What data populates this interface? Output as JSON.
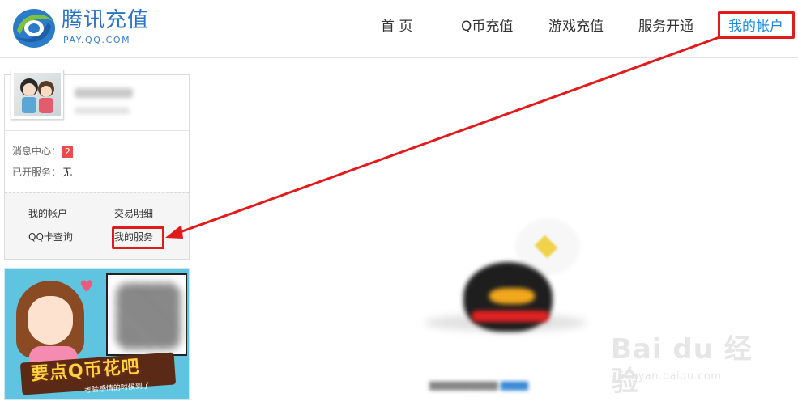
{
  "header": {
    "logo_cn": "腾讯充值",
    "logo_en": "PAY.QQ.COM",
    "nav": [
      {
        "label": "首  页"
      },
      {
        "label": "Q币充值"
      },
      {
        "label": "游戏充值"
      },
      {
        "label": "服务开通"
      },
      {
        "label": "我的帐户"
      }
    ],
    "active_index": 4
  },
  "user_panel": {
    "message_center_label": "消息中心：",
    "message_count": "2",
    "services_label": "已开服务：",
    "services_value": "无",
    "links": {
      "my_account": "我的帐户",
      "transactions": "交易明细",
      "qq_card": "QQ卡查询",
      "my_services": "我的服务"
    }
  },
  "banner": {
    "title": "要点Q币花吧",
    "subtitle": "考验感情的时候到了..."
  },
  "watermark": {
    "brand": "Bai du 经验",
    "url": "jingyan.baidu.com"
  },
  "colors": {
    "brand_blue": "#2a73c1",
    "active_nav": "#1a8be0",
    "annotation_red": "#e01b1b",
    "badge_red": "#e84c4c"
  },
  "icons": {
    "logo": "tencent-pay-logo-icon",
    "avatar": "user-avatar",
    "mascot": "qq-penguin-empty-icon"
  }
}
